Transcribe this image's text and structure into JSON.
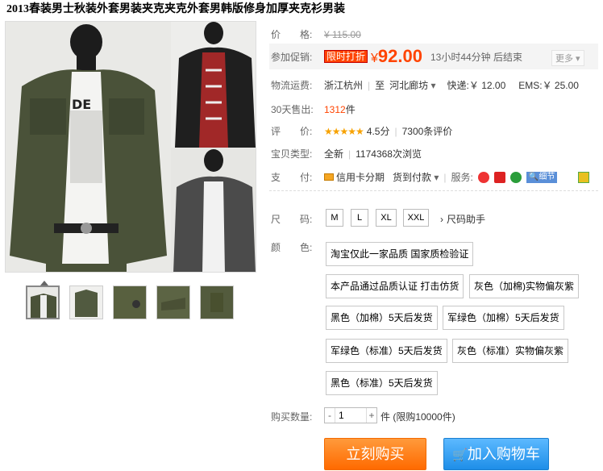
{
  "title": "2013春装男士秋装外套男装夹克夹克外套男韩版修身加厚夹克衫男装",
  "price": {
    "label": "价　　格:",
    "original": "¥ 115.00"
  },
  "promo": {
    "label": "参加促销:",
    "tag": "限时打折",
    "yen": "¥",
    "price": "92.00",
    "countdown": "13小时44分钟 后结束",
    "more": "更多"
  },
  "shipping": {
    "label": "物流运费:",
    "from": "浙江杭州",
    "to_prefix": "至",
    "to": "河北廊坊",
    "express": "快递:￥ 12.00",
    "ems": "EMS:￥ 25.00"
  },
  "sales": {
    "label": "30天售出:",
    "count": "1312",
    "unit": "件"
  },
  "rating": {
    "label": "评　　价:",
    "stars": "★★★★★",
    "score": "4.5分",
    "reviews": "7300条评价"
  },
  "item_type": {
    "label": "宝贝类型:",
    "value": "全新",
    "views": "1174368次浏览"
  },
  "payment": {
    "label": "支　　付:",
    "credit": "信用卡分期",
    "cod": "货到付款",
    "service_label": "服务:",
    "detail": "细节"
  },
  "size": {
    "label": "尺　　码:",
    "options": [
      "M",
      "L",
      "XL",
      "XXL"
    ],
    "helper": "尺码助手"
  },
  "color": {
    "label": "颜　　色:",
    "options": [
      "淘宝仅此一家品质 国家质检验证",
      "本产品通过品质认证 打击仿货",
      "灰色（加棉)实物偏灰紫",
      "黑色（加棉）5天后发货",
      "军绿色（加棉）5天后发货",
      "军绿色（标准）5天后发货",
      "灰色（标准）实物偏灰紫",
      "黑色（标准）5天后发货"
    ]
  },
  "quantity": {
    "label": "购买数量:",
    "value": "1",
    "minus": "-",
    "plus": "+",
    "unit": "件 (限购10000件)"
  },
  "buttons": {
    "buy_now": "立刻购买",
    "add_cart": "加入购物车"
  },
  "colors": {
    "accent": "#ff4400",
    "buy": "#ff7a00",
    "cart": "#2a96ec"
  }
}
